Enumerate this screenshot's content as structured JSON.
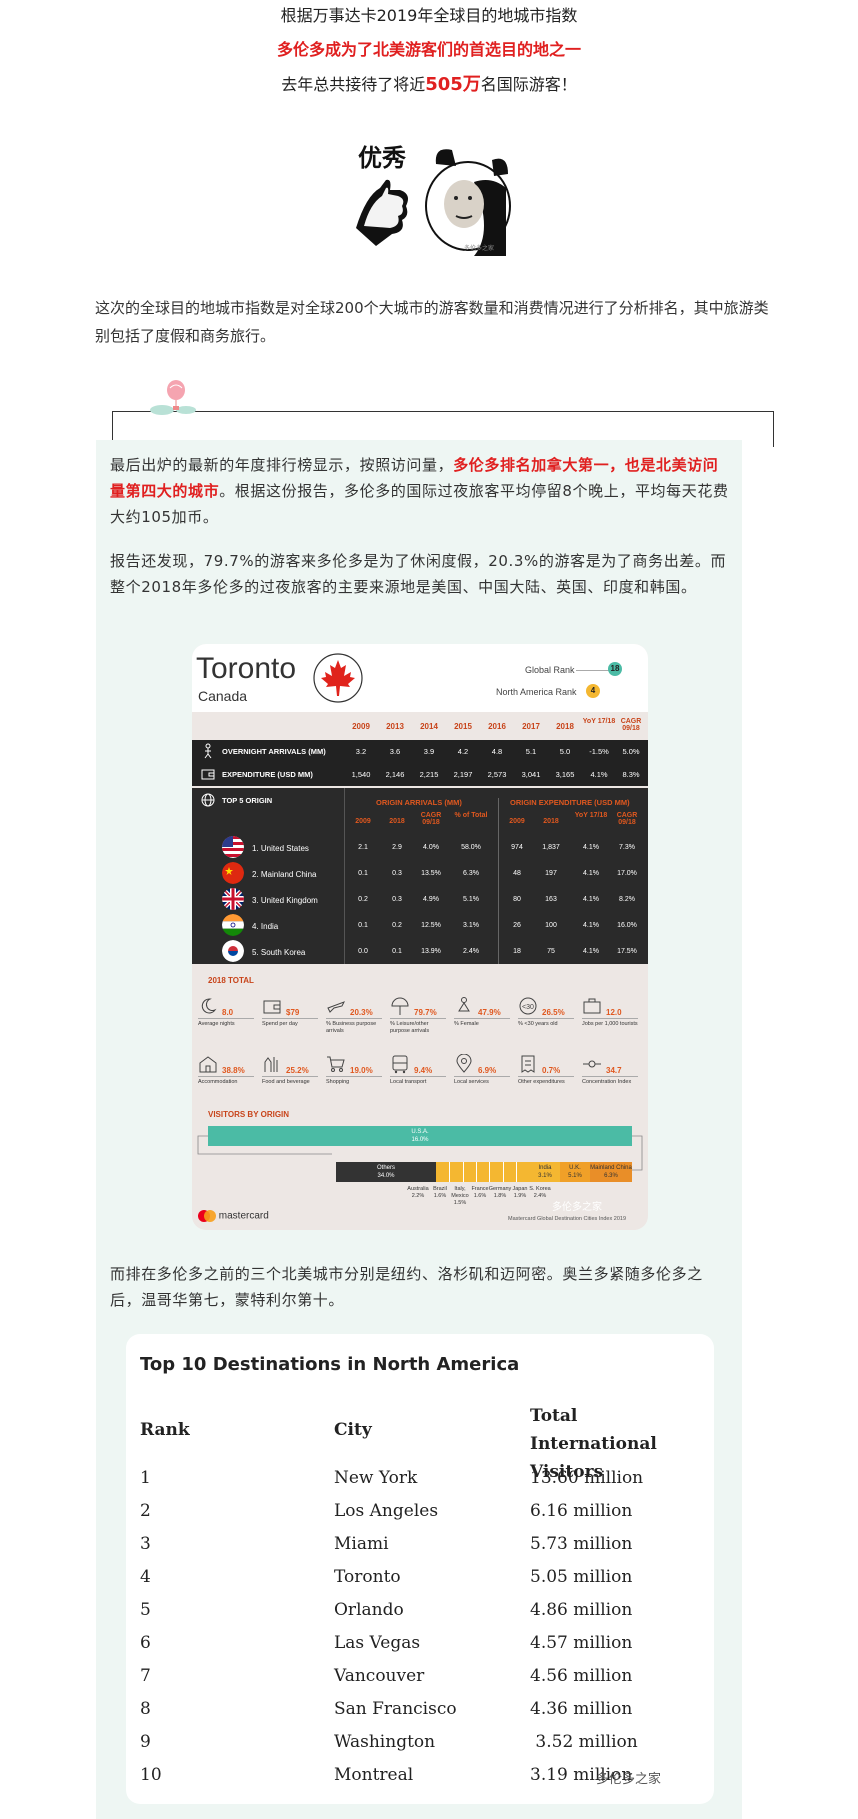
{
  "intro": {
    "line1": "根据万事达卡2019年全球目的地城市指数",
    "line2": "多伦多成为了北美游客们的首选目的地之一",
    "line3_pre": "去年总共接待了将近",
    "line3_num": "505万",
    "line3_post": "名国际游客！"
  },
  "meme": {
    "word": "优秀"
  },
  "para1": "这次的全球目的地城市指数是对全球200个大城市的游客数量和消费情况进行了分析排名，其中旅游类别包括了度假和商务旅行。",
  "para2": {
    "pre": "最后出炉的最新的年度排行榜显示，按照访问量，",
    "red": "多伦多排名加拿大第一，也是北美访问量第四大的城市",
    "post": "。根据这份报告，多伦多的国际过夜旅客平均停留8个晚上，平均每天花费大约105加币。"
  },
  "para3": "报告还发现，79.7%的游客来多伦多是为了休闲度假，20.3%的游客是为了商务出差。而整个2018年多伦多的过夜旅客的主要来源地是美国、中国大陆、英国、印度和韩国。",
  "infographic": {
    "city": "Toronto",
    "country": "Canada",
    "global_rank_label": "Global Rank",
    "global_rank": "18",
    "na_rank_label": "North America Rank",
    "na_rank": "4",
    "years": [
      "2009",
      "2013",
      "2014",
      "2015",
      "2016",
      "2017",
      "2018",
      "YoY 17/18",
      "CAGR 09/18"
    ],
    "arrivals_label": "OVERNIGHT ARRIVALS (MM)",
    "arrivals": [
      "3.2",
      "3.6",
      "3.9",
      "4.2",
      "4.8",
      "5.1",
      "5.0",
      "-1.5%",
      "5.0%"
    ],
    "expenditure_label": "EXPENDITURE (USD MM)",
    "expenditure": [
      "1,540",
      "2,146",
      "2,215",
      "2,197",
      "2,573",
      "3,041",
      "3,165",
      "4.1%",
      "8.3%"
    ],
    "top5_label": "TOP 5 ORIGIN",
    "origin_arrivals_label": "ORIGIN ARRIVALS (MM)",
    "origin_exp_label": "ORIGIN EXPENDITURE (USD MM)",
    "origin_cols_left": [
      "2009",
      "2018",
      "CAGR 09/18",
      "% of Total"
    ],
    "origin_cols_right": [
      "2009",
      "2018",
      "YoY 17/18",
      "CAGR 09/18"
    ],
    "origins": [
      {
        "name": "1. United States",
        "vals": [
          "2.1",
          "2.9",
          "4.0%",
          "58.0%",
          "974",
          "1,837",
          "4.1%",
          "7.3%"
        ]
      },
      {
        "name": "2. Mainland China",
        "vals": [
          "0.1",
          "0.3",
          "13.5%",
          "6.3%",
          "48",
          "197",
          "4.1%",
          "17.0%"
        ]
      },
      {
        "name": "3. United Kingdom",
        "vals": [
          "0.2",
          "0.3",
          "4.9%",
          "5.1%",
          "80",
          "163",
          "4.1%",
          "8.2%"
        ]
      },
      {
        "name": "4. India",
        "vals": [
          "0.1",
          "0.2",
          "12.5%",
          "3.1%",
          "26",
          "100",
          "4.1%",
          "16.0%"
        ]
      },
      {
        "name": "5. South Korea",
        "vals": [
          "0.0",
          "0.1",
          "13.9%",
          "2.4%",
          "18",
          "75",
          "4.1%",
          "17.5%"
        ]
      }
    ],
    "total_label": "2018 TOTAL",
    "stats_row1": [
      {
        "val": "8.0",
        "lab": "Average nights"
      },
      {
        "val": "$79",
        "lab": "Spend per day"
      },
      {
        "val": "20.3%",
        "lab": "% Business purpose arrivals"
      },
      {
        "val": "79.7%",
        "lab": "% Leisure/other purpose arrivals"
      },
      {
        "val": "47.9%",
        "lab": "% Female"
      },
      {
        "val": "26.5%",
        "lab": "% <30 years old"
      },
      {
        "val": "12.0",
        "lab": "Jobs per 1,000 tourists"
      }
    ],
    "stats_row2": [
      {
        "val": "38.8%",
        "lab": "Accommodation"
      },
      {
        "val": "25.2%",
        "lab": "Food and beverage"
      },
      {
        "val": "19.0%",
        "lab": "Shopping"
      },
      {
        "val": "9.4%",
        "lab": "Local transport"
      },
      {
        "val": "6.9%",
        "lab": "Local services"
      },
      {
        "val": "0.7%",
        "lab": "Other expenditures"
      },
      {
        "val": "34.7",
        "lab": "Concentration Index"
      }
    ],
    "visitors_label": "VISITORS BY ORIGIN",
    "usa_bar": {
      "name": "U.S.A.",
      "pct": "16.0%"
    },
    "others_bar": {
      "name": "Others",
      "pct": "34.0%"
    },
    "india_bar": {
      "name": "India",
      "pct": "3.1%"
    },
    "uk_bar": {
      "name": "U.K.",
      "pct": "5.1%"
    },
    "china_bar": {
      "name": "Mainland China",
      "pct": "6.3%"
    },
    "small_origins": [
      {
        "name": "Australia",
        "pct": "2.2%"
      },
      {
        "name": "Brazil",
        "pct": "1.6%"
      },
      {
        "name": "Italy, Mexico",
        "pct": "1.5%"
      },
      {
        "name": "France",
        "pct": "1.6%"
      },
      {
        "name": "Germany",
        "pct": "1.8%"
      },
      {
        "name": "Japan",
        "pct": "1.9%"
      },
      {
        "name": "S. Korea",
        "pct": "2.4%"
      }
    ],
    "logo": "mastercard",
    "source": "Mastercard Global Destination Cities Index 2019",
    "watermark": "多伦多之家"
  },
  "para4": "而排在多伦多之前的三个北美城市分别是纽约、洛杉矶和迈阿密。奥兰多紧随多伦多之后，温哥华第七，蒙特利尔第十。",
  "top10": {
    "title": "Top 10 Destinations in North America",
    "headers": [
      "Rank",
      "City",
      "Total International Visitors"
    ],
    "rows": [
      [
        "1",
        "New York",
        "13.60 million"
      ],
      [
        "2",
        "Los Angeles",
        "6.16 million"
      ],
      [
        "3",
        "Miami",
        "5.73 million"
      ],
      [
        "4",
        "Toronto",
        "5.05 million"
      ],
      [
        "5",
        "Orlando",
        "4.86 million"
      ],
      [
        "6",
        "Las Vegas",
        "4.57 million"
      ],
      [
        "7",
        "Vancouver",
        "4.56 million"
      ],
      [
        "8",
        "San Francisco",
        "4.36 million"
      ],
      [
        "9",
        "Washington",
        " 3.52 million"
      ],
      [
        "10",
        "Montreal",
        "3.19 million"
      ]
    ],
    "watermark": "多伦多之家"
  }
}
